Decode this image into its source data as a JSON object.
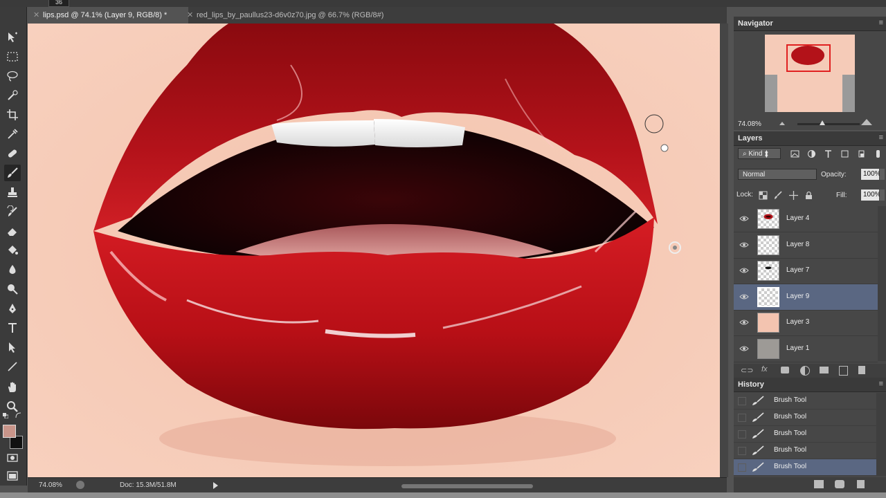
{
  "options_bar": {
    "brush_size": "36"
  },
  "tabs": [
    {
      "label": "lips.psd @ 74.1% (Layer 9, RGB/8) *",
      "active": true
    },
    {
      "label": "red_lips_by_paullus23-d6v0z70.jpg @ 66.7% (RGB/8#)",
      "active": false
    }
  ],
  "tools": [
    "move-icon",
    "marquee-icon",
    "lasso-icon",
    "quick-select-icon",
    "crop-icon",
    "eyedropper-icon",
    "healing-icon",
    "brush-icon",
    "stamp-icon",
    "history-brush-icon",
    "eraser-icon",
    "paint-bucket-icon",
    "blur-icon",
    "dodge-icon",
    "pen-icon",
    "type-icon",
    "path-select-icon",
    "line-icon",
    "hand-icon",
    "zoom-icon"
  ],
  "colors": {
    "foreground": "#c9958a",
    "background": "#111111",
    "selection": "#5a6782"
  },
  "status": {
    "zoom": "74.08%",
    "doc": "Doc: 15.3M/51.8M"
  },
  "navigator": {
    "title": "Navigator",
    "zoom": "74.08%"
  },
  "layers": {
    "title": "Layers",
    "filter_label": "Kind",
    "blend_mode": "Normal",
    "opacity_label": "Opacity:",
    "opacity_value": "100%",
    "lock_label": "Lock:",
    "fill_label": "Fill:",
    "fill_value": "100%",
    "items": [
      {
        "name": "Layer 4",
        "thumb": "lips",
        "selected": false
      },
      {
        "name": "Layer 8",
        "thumb": "empty",
        "selected": false
      },
      {
        "name": "Layer 7",
        "thumb": "mouth",
        "selected": false
      },
      {
        "name": "Layer 9",
        "thumb": "empty",
        "selected": true
      },
      {
        "name": "Layer 3",
        "thumb": "skin",
        "selected": false
      },
      {
        "name": "Layer 1",
        "thumb": "gray",
        "selected": false
      }
    ]
  },
  "history": {
    "title": "History",
    "items": [
      {
        "name": "Brush Tool",
        "selected": false
      },
      {
        "name": "Brush Tool",
        "selected": false
      },
      {
        "name": "Brush Tool",
        "selected": false
      },
      {
        "name": "Brush Tool",
        "selected": false
      },
      {
        "name": "Brush Tool",
        "selected": true
      }
    ]
  }
}
